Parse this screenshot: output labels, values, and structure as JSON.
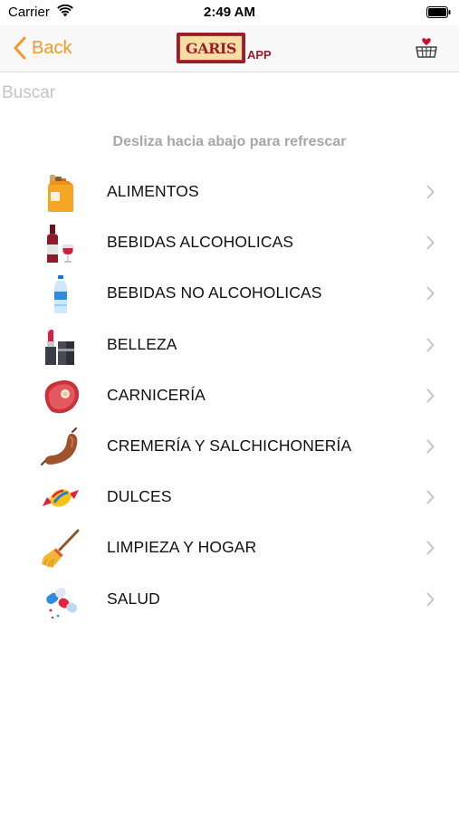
{
  "status_bar": {
    "carrier": "Carrier",
    "time": "2:49 AM"
  },
  "nav": {
    "back_label": "Back",
    "logo_text": "GARIS",
    "logo_suffix": "APP",
    "accent_color": "#f39a2b",
    "brand_color": "#9a1e2a"
  },
  "search": {
    "placeholder": "Buscar",
    "value": ""
  },
  "refresh_hint": "Desliza hacia abajo para refrescar",
  "categories": [
    {
      "label": "ALIMENTOS",
      "icon": "grocery-bag-icon"
    },
    {
      "label": "BEBIDAS ALCOHOLICAS",
      "icon": "wine-icon"
    },
    {
      "label": "BEBIDAS NO ALCOHOLICAS",
      "icon": "water-bottle-icon"
    },
    {
      "label": "BELLEZA",
      "icon": "lipstick-icon"
    },
    {
      "label": "CARNICERÍA",
      "icon": "steak-icon"
    },
    {
      "label": "CREMERÍA Y SALCHICHONERÍA",
      "icon": "sausage-icon"
    },
    {
      "label": "DULCES",
      "icon": "candy-icon"
    },
    {
      "label": "LIMPIEZA Y HOGAR",
      "icon": "broom-icon"
    },
    {
      "label": "SALUD",
      "icon": "pills-icon"
    }
  ]
}
